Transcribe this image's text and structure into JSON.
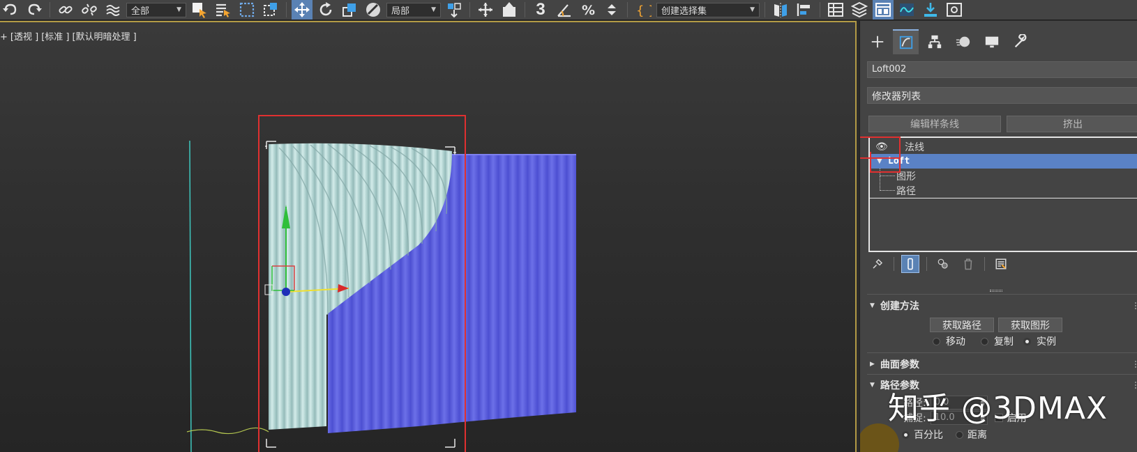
{
  "toolbar": {
    "selection_filter": "全部",
    "ref_coord": "局部",
    "named_selection": "创建选择集",
    "snap_label": "3"
  },
  "viewport": {
    "labels": [
      "+",
      "[透视 ]",
      "[标准 ]",
      "[默认明暗处理 ]"
    ],
    "selection_box_color": "#e03030",
    "curtain_front_color": "#b7d8d6",
    "curtain_back_color": "#5c5fd8"
  },
  "command_panel": {
    "object_name": "Loft002",
    "modifier_list": "修改器列表",
    "buttons": [
      "编辑样条线",
      "挤出"
    ],
    "stack": [
      {
        "label": "法线"
      },
      {
        "label": "Loft"
      },
      {
        "label": "图形"
      },
      {
        "label": "路径"
      }
    ],
    "rollouts": {
      "creation_method": {
        "title": "创建方法",
        "get_path": "获取路径",
        "get_shape": "获取图形",
        "options": [
          "移动",
          "复制",
          "实例"
        ]
      },
      "surface_params": {
        "title": "曲面参数"
      },
      "path_params": {
        "title": "路径参数",
        "path_label": "路径:",
        "path_value": "0.0",
        "snap_label": "捕捉:",
        "snap_value": "10.0",
        "enable_label": "启用",
        "percent_label": "百分比",
        "distance_label": "距离"
      }
    }
  },
  "watermark": "知乎 @3DMAX"
}
